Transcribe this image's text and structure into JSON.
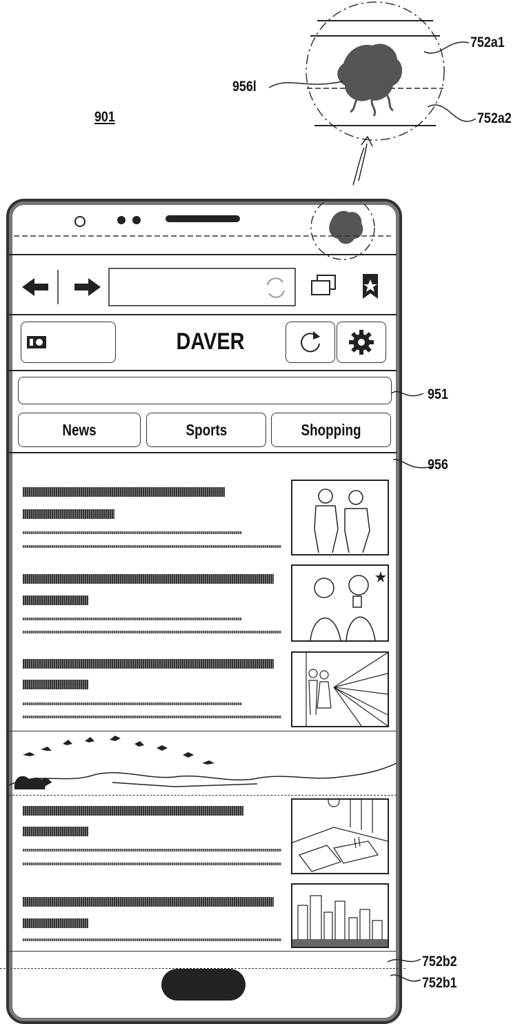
{
  "figure_ref": "901",
  "labels": {
    "zoom_top": "752a1",
    "zoom_mark": "956l",
    "zoom_bottom": "752a2",
    "search_bar": "951",
    "content_area": "956",
    "bottom_upper": "752b2",
    "bottom_lower": "752b1"
  },
  "page": {
    "title": "DAVER",
    "tabs": [
      "News",
      "Sports",
      "Shopping"
    ]
  },
  "icons": {
    "back": "arrow-left",
    "forward": "arrow-right",
    "reload_in_address": "refresh",
    "windows": "stacked-windows",
    "bookmark": "bookmark-star",
    "camera": "camera",
    "refresh": "refresh",
    "settings": "gear"
  },
  "articles": [
    {
      "thumbnail": "two men posing"
    },
    {
      "thumbnail": "people taking selfie"
    },
    {
      "thumbnail": "couple in hallway"
    },
    {
      "thumbnail": "living room interior"
    },
    {
      "thumbnail": "city skyline"
    }
  ],
  "banner": "ski jumpers over mountains"
}
